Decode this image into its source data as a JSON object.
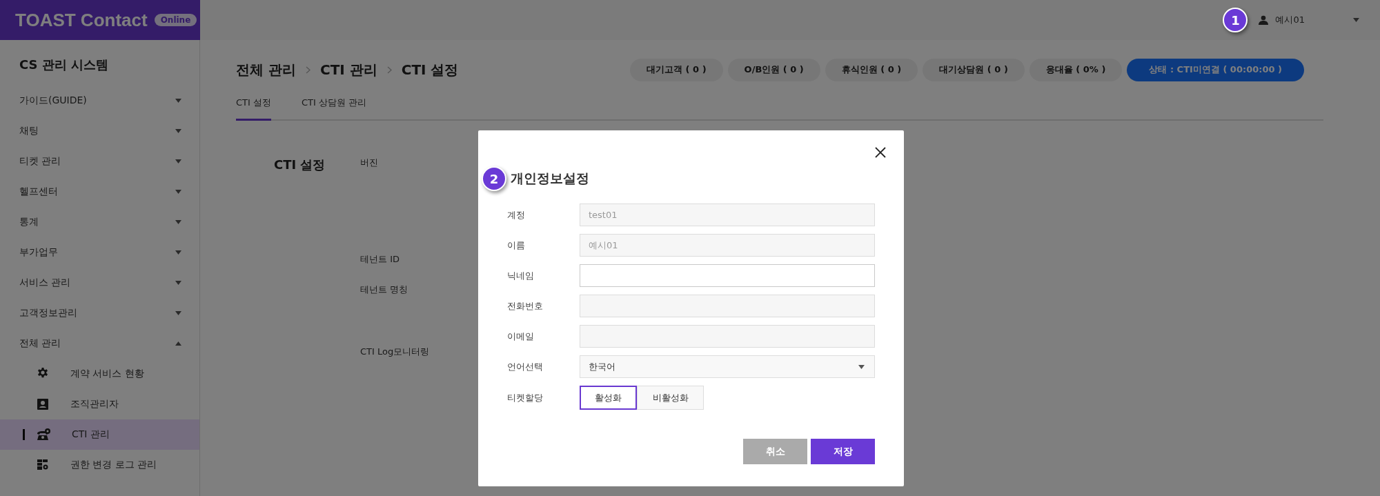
{
  "header": {
    "logo_text": "TOAST Contact",
    "logo_badge": "Online",
    "marker": "1",
    "user": {
      "name": "예시01"
    }
  },
  "sidebar": {
    "title": "CS 관리 시스템",
    "items": [
      {
        "label": "가이드(GUIDE)",
        "expanded": false
      },
      {
        "label": "채팅",
        "expanded": false
      },
      {
        "label": "티켓 관리",
        "expanded": false
      },
      {
        "label": "헬프센터",
        "expanded": false
      },
      {
        "label": "통계",
        "expanded": false
      },
      {
        "label": "부가업무",
        "expanded": false
      },
      {
        "label": "서비스 관리",
        "expanded": false
      },
      {
        "label": "고객정보관리",
        "expanded": false
      },
      {
        "label": "전체 관리",
        "expanded": true,
        "children": [
          {
            "label": "계약 서비스 현황",
            "selected": false
          },
          {
            "label": "조직관리자",
            "selected": false
          },
          {
            "label": "CTI 관리",
            "selected": true
          },
          {
            "label": "권한 변경 로그 관리",
            "selected": false
          }
        ]
      }
    ]
  },
  "breadcrumb": [
    "전체 관리",
    "CTI 관리",
    "CTI 설정"
  ],
  "status_pills": [
    {
      "label": "대기고객 ( 0 )",
      "kind": "count"
    },
    {
      "label": "O/B인원 ( 0 )",
      "kind": "count"
    },
    {
      "label": "휴식인원 ( 0 )",
      "kind": "count"
    },
    {
      "label": "대기상담원 ( 0 )",
      "kind": "count"
    },
    {
      "label": "응대율 ( 0% )",
      "kind": "count"
    },
    {
      "label": "상태 : CTI미연결 ( 00:00:00 )",
      "kind": "status"
    }
  ],
  "tabs": [
    {
      "label": "CTI 설정",
      "selected": true
    },
    {
      "label": "CTI 상담원 관리",
      "selected": false
    }
  ],
  "section": {
    "title": "CTI 설정",
    "labels": [
      "버진",
      "테넌트 ID",
      "테넌트 명칭",
      "CTI Log모니터링"
    ]
  },
  "modal": {
    "title": "개인정보설정",
    "marker": "2",
    "fields": [
      {
        "label": "계정",
        "kind": "readonly",
        "value": "test01"
      },
      {
        "label": "이름",
        "kind": "readonly",
        "value": "예시01"
      },
      {
        "label": "닉네임",
        "kind": "text"
      },
      {
        "label": "전화번호",
        "kind": "readonly"
      },
      {
        "label": "이메일",
        "kind": "readonly"
      },
      {
        "label": "언어선택",
        "kind": "select",
        "value": "한국어"
      },
      {
        "label": "티켓할당",
        "kind": "toggle",
        "options": [
          {
            "label": "활성화",
            "selected": true
          },
          {
            "label": "비활성화",
            "selected": false
          }
        ]
      }
    ],
    "buttons": [
      {
        "label": "취소",
        "kind": "secondary"
      },
      {
        "label": "저장",
        "kind": "primary"
      }
    ]
  }
}
